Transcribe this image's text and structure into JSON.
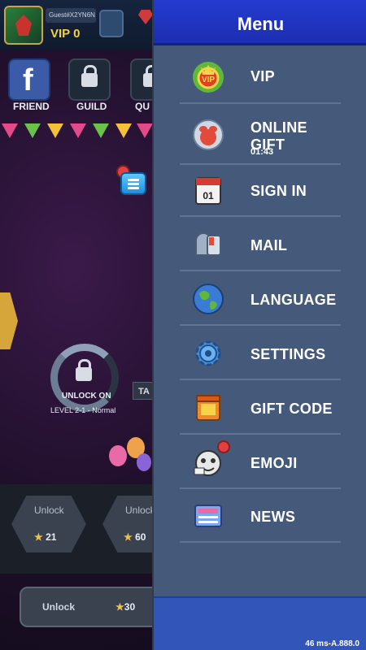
{
  "game": {
    "player": {
      "guest_id": "Guest#X2YN6N",
      "vip_label": "VIP 0"
    },
    "top_buttons": [
      {
        "label": "FRIEND",
        "icon": "facebook-icon"
      },
      {
        "label": "GUILD",
        "icon": "lock-icon"
      },
      {
        "label": "QU",
        "icon": "lock-icon"
      }
    ],
    "stage": {
      "unlock_text": "UNLOCK ON",
      "level_text": "LEVEL 2-1 - Normal",
      "tab_partial": "TA"
    },
    "bottom_slots": [
      {
        "label": "Unlock",
        "cost": "21"
      },
      {
        "label": "Unlock",
        "cost": "60"
      }
    ],
    "unlock_bar": {
      "label": "Unlock",
      "cost": "30"
    }
  },
  "menu": {
    "title": "Menu",
    "items": [
      {
        "label": "VIP",
        "icon": "vip-badge-icon"
      },
      {
        "label": "ONLINE GIFT",
        "sub": "01:43",
        "icon": "online-gift-icon"
      },
      {
        "label": "SIGN IN",
        "icon": "calendar-icon"
      },
      {
        "label": "MAIL",
        "icon": "mailbox-icon"
      },
      {
        "label": "LANGUAGE",
        "icon": "globe-icon"
      },
      {
        "label": "SETTINGS",
        "icon": "gear-icon"
      },
      {
        "label": "GIFT CODE",
        "icon": "gift-box-icon"
      },
      {
        "label": "EMOJI",
        "icon": "emoji-icon",
        "has_notification": true
      },
      {
        "label": "NEWS",
        "icon": "news-icon"
      }
    ]
  },
  "status": {
    "fps": "46 ms-A.888.0"
  },
  "colors": {
    "menu_header": "#1c2eb0",
    "menu_bg": "#45597a",
    "menu_footer": "#3155b8",
    "notification": "#e24040"
  }
}
